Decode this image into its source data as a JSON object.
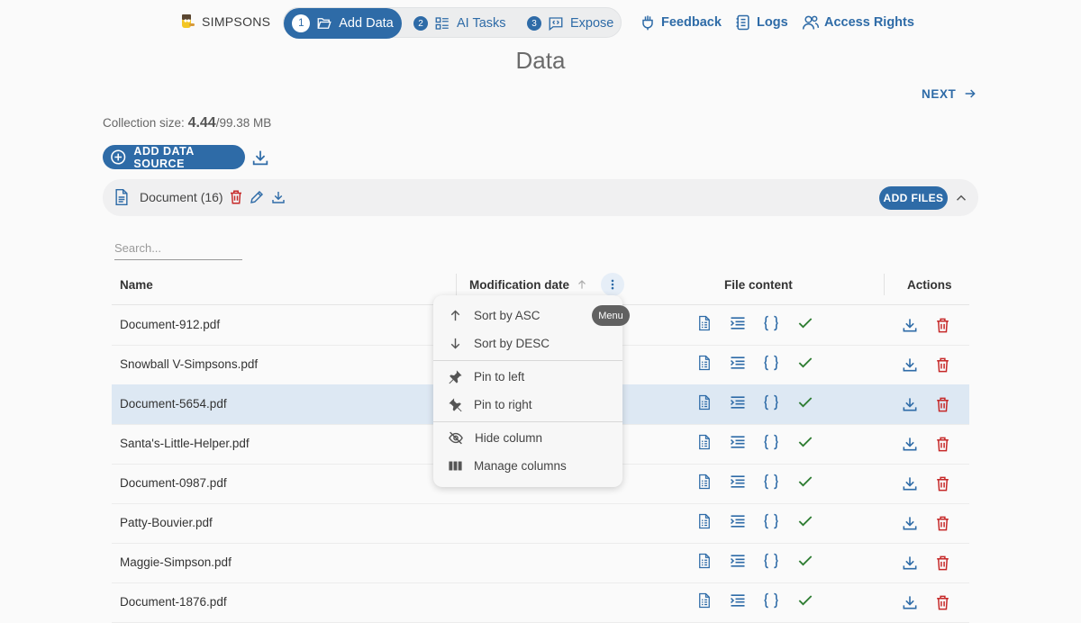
{
  "brand": {
    "name": "SIMPSONS"
  },
  "stepper": [
    {
      "num": "1",
      "label": "Add Data",
      "active": true
    },
    {
      "num": "2",
      "label": "AI Tasks"
    },
    {
      "num": "3",
      "label": "Expose"
    }
  ],
  "nav": {
    "feedback": "Feedback",
    "logs": "Logs",
    "access": "Access Rights"
  },
  "page": {
    "title": "Data",
    "next": "NEXT"
  },
  "collection": {
    "label": "Collection size:",
    "used": "4.44",
    "total": "/99.38 MB"
  },
  "toolbar": {
    "add_source": "ADD DATA SOURCE"
  },
  "docsource": {
    "label": "Document (16)",
    "add_files": "ADD FILES"
  },
  "search": {
    "placeholder": "Search..."
  },
  "table": {
    "columns": {
      "name": "Name",
      "modified": "Modification date",
      "content": "File content",
      "actions": "Actions"
    },
    "rows": [
      "Document-912.pdf",
      "Snowball V-Simpsons.pdf",
      "Document-5654.pdf",
      "Santa's-Little-Helper.pdf",
      "Document-0987.pdf",
      "Patty-Bouvier.pdf",
      "Maggie-Simpson.pdf",
      "Document-1876.pdf"
    ],
    "selected_row": 2
  },
  "column_menu": {
    "tooltip": "Menu",
    "items": {
      "sort_asc": "Sort by ASC",
      "sort_desc": "Sort by DESC",
      "pin_left": "Pin to left",
      "pin_right": "Pin to right",
      "hide": "Hide column",
      "manage": "Manage columns"
    }
  },
  "colors": {
    "primary": "#2e6ba7",
    "danger": "#c62828",
    "success": "#2e7d32",
    "selected_row": "#dde8f3"
  }
}
